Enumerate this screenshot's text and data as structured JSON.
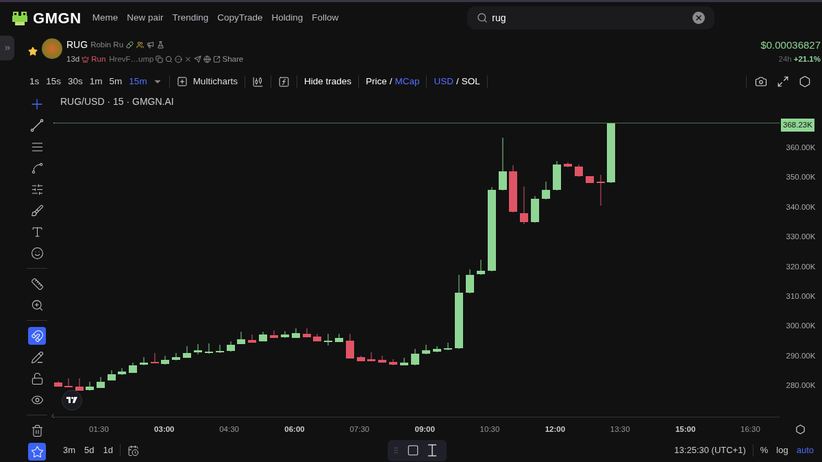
{
  "brand": {
    "name": "GMGN"
  },
  "nav": [
    {
      "label": "Meme"
    },
    {
      "label": "New pair"
    },
    {
      "label": "Trending"
    },
    {
      "label": "CopyTrade"
    },
    {
      "label": "Holding"
    },
    {
      "label": "Follow"
    }
  ],
  "search": {
    "value": "rug"
  },
  "token": {
    "symbol": "RUG",
    "name": "Robin Ru",
    "favorited": true,
    "age": "13d",
    "launchpad": "Run",
    "address": "HrevF…ump",
    "share": "Share",
    "price": "$0.00036827",
    "change_period": "24h",
    "change": "+21.1%"
  },
  "intervals": [
    {
      "label": "1s",
      "selected": false
    },
    {
      "label": "15s",
      "selected": false
    },
    {
      "label": "30s",
      "selected": false
    },
    {
      "label": "1m",
      "selected": false
    },
    {
      "label": "5m",
      "selected": false
    },
    {
      "label": "15m",
      "selected": true
    }
  ],
  "toolbar": {
    "multicharts": "Multicharts",
    "hide_trades": "Hide trades",
    "price_mode": [
      {
        "label": "Price",
        "selected": false
      },
      {
        "label": "MCap",
        "selected": true
      }
    ],
    "price_separator": "/",
    "currency": [
      {
        "label": "USD",
        "selected": true
      },
      {
        "label": "SOL",
        "selected": false
      }
    ],
    "currency_separator": "/"
  },
  "drawing_tools": [
    {
      "kind": "crosshair",
      "active": true
    },
    {
      "kind": "trend-line",
      "active": false
    },
    {
      "kind": "parallel-lines",
      "active": false
    },
    {
      "kind": "pattern",
      "active": false
    },
    {
      "kind": "fib",
      "active": false
    },
    {
      "kind": "brush",
      "active": false
    },
    {
      "kind": "text",
      "active": false
    },
    {
      "kind": "emoji",
      "active": false
    },
    {
      "kind": "ruler",
      "active": false
    },
    {
      "kind": "zoom",
      "active": false
    },
    {
      "kind": "magnet",
      "active": true
    },
    {
      "kind": "lock-drawing",
      "active": false
    },
    {
      "kind": "lock",
      "active": false
    },
    {
      "kind": "eye",
      "active": false
    },
    {
      "kind": "trash",
      "active": false
    },
    {
      "kind": "star",
      "active": true
    }
  ],
  "chart": {
    "legend": "RUG/USD · 15 · GMGN.AI",
    "last_price": "368.23K",
    "yaxis": [
      "360.00K",
      "350.00K",
      "340.00K",
      "330.00K",
      "320.00K",
      "310.00K",
      "300.00K",
      "290.00K",
      "280.00K"
    ],
    "xaxis": [
      {
        "label": "01:30",
        "major": false
      },
      {
        "label": "03:00",
        "major": true
      },
      {
        "label": "04:30",
        "major": false
      },
      {
        "label": "06:00",
        "major": true
      },
      {
        "label": "07:30",
        "major": false
      },
      {
        "label": "09:00",
        "major": true
      },
      {
        "label": "10:30",
        "major": false
      },
      {
        "label": "12:00",
        "major": true
      },
      {
        "label": "13:30",
        "major": false
      },
      {
        "label": "15:00",
        "major": true
      },
      {
        "label": "16:30",
        "major": false
      }
    ]
  },
  "ranges": [
    {
      "label": "3m"
    },
    {
      "label": "5d"
    },
    {
      "label": "1d"
    }
  ],
  "clock": "13:25:30 (UTC+1)",
  "scale_options": [
    {
      "label": "%",
      "selected": false
    },
    {
      "label": "log",
      "selected": false
    },
    {
      "label": "auto",
      "selected": true
    }
  ]
}
